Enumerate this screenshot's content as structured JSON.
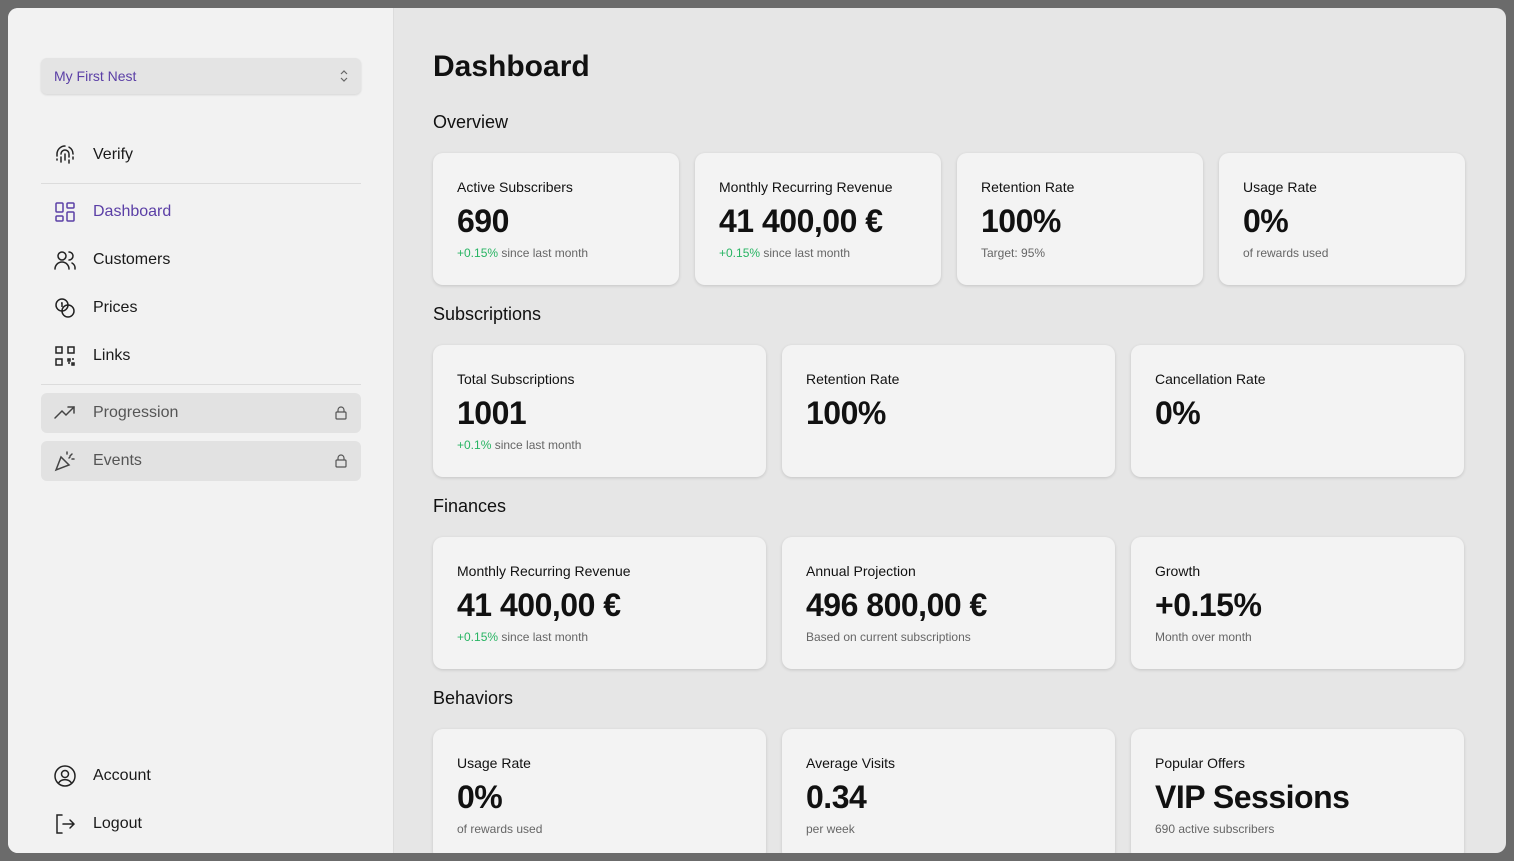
{
  "sidebar": {
    "nest_select": "My First Nest",
    "verify": "Verify",
    "items": [
      {
        "label": "Dashboard",
        "icon": "grid-icon",
        "active": true
      },
      {
        "label": "Customers",
        "icon": "users-icon"
      },
      {
        "label": "Prices",
        "icon": "coins-icon"
      },
      {
        "label": "Links",
        "icon": "qr-code-icon"
      }
    ],
    "locked": [
      {
        "label": "Progression",
        "icon": "trending-up-icon"
      },
      {
        "label": "Events",
        "icon": "party-popper-icon"
      }
    ],
    "account": "Account",
    "logout": "Logout"
  },
  "page": {
    "title": "Dashboard"
  },
  "overview": {
    "title": "Overview",
    "cards": [
      {
        "title": "Active Subscribers",
        "value": "690",
        "delta": "+0.15%",
        "sub": " since last month"
      },
      {
        "title": "Monthly Recurring Revenue",
        "value": "41 400,00 €",
        "delta": "+0.15%",
        "sub": " since last month"
      },
      {
        "title": "Retention Rate",
        "value": "100%",
        "delta": "",
        "sub": "Target: 95%"
      },
      {
        "title": "Usage Rate",
        "value": "0%",
        "delta": "",
        "sub": "of rewards used"
      }
    ]
  },
  "subscriptions": {
    "title": "Subscriptions",
    "cards": [
      {
        "title": "Total Subscriptions",
        "value": "1001",
        "delta": "+0.1%",
        "sub": " since last month"
      },
      {
        "title": "Retention Rate",
        "value": "100%",
        "delta": "",
        "sub": ""
      },
      {
        "title": "Cancellation Rate",
        "value": "0%",
        "delta": "",
        "sub": ""
      }
    ]
  },
  "finances": {
    "title": "Finances",
    "cards": [
      {
        "title": "Monthly Recurring Revenue",
        "value": "41 400,00 €",
        "delta": "+0.15%",
        "sub": " since last month"
      },
      {
        "title": "Annual Projection",
        "value": "496 800,00 €",
        "delta": "",
        "sub": "Based on current subscriptions"
      },
      {
        "title": "Growth",
        "value": "+0.15%",
        "delta": "",
        "sub": "Month over month"
      }
    ]
  },
  "behaviors": {
    "title": "Behaviors",
    "cards": [
      {
        "title": "Usage Rate",
        "value": "0%",
        "delta": "",
        "sub": "of rewards used"
      },
      {
        "title": "Average Visits",
        "value": "0.34",
        "delta": "",
        "sub": "per week"
      },
      {
        "title": "Popular Offers",
        "value": "VIP Sessions",
        "delta": "",
        "sub": "690 active subscribers"
      }
    ]
  },
  "colors": {
    "accent": "#5b3fa6",
    "positive": "#28b463"
  }
}
